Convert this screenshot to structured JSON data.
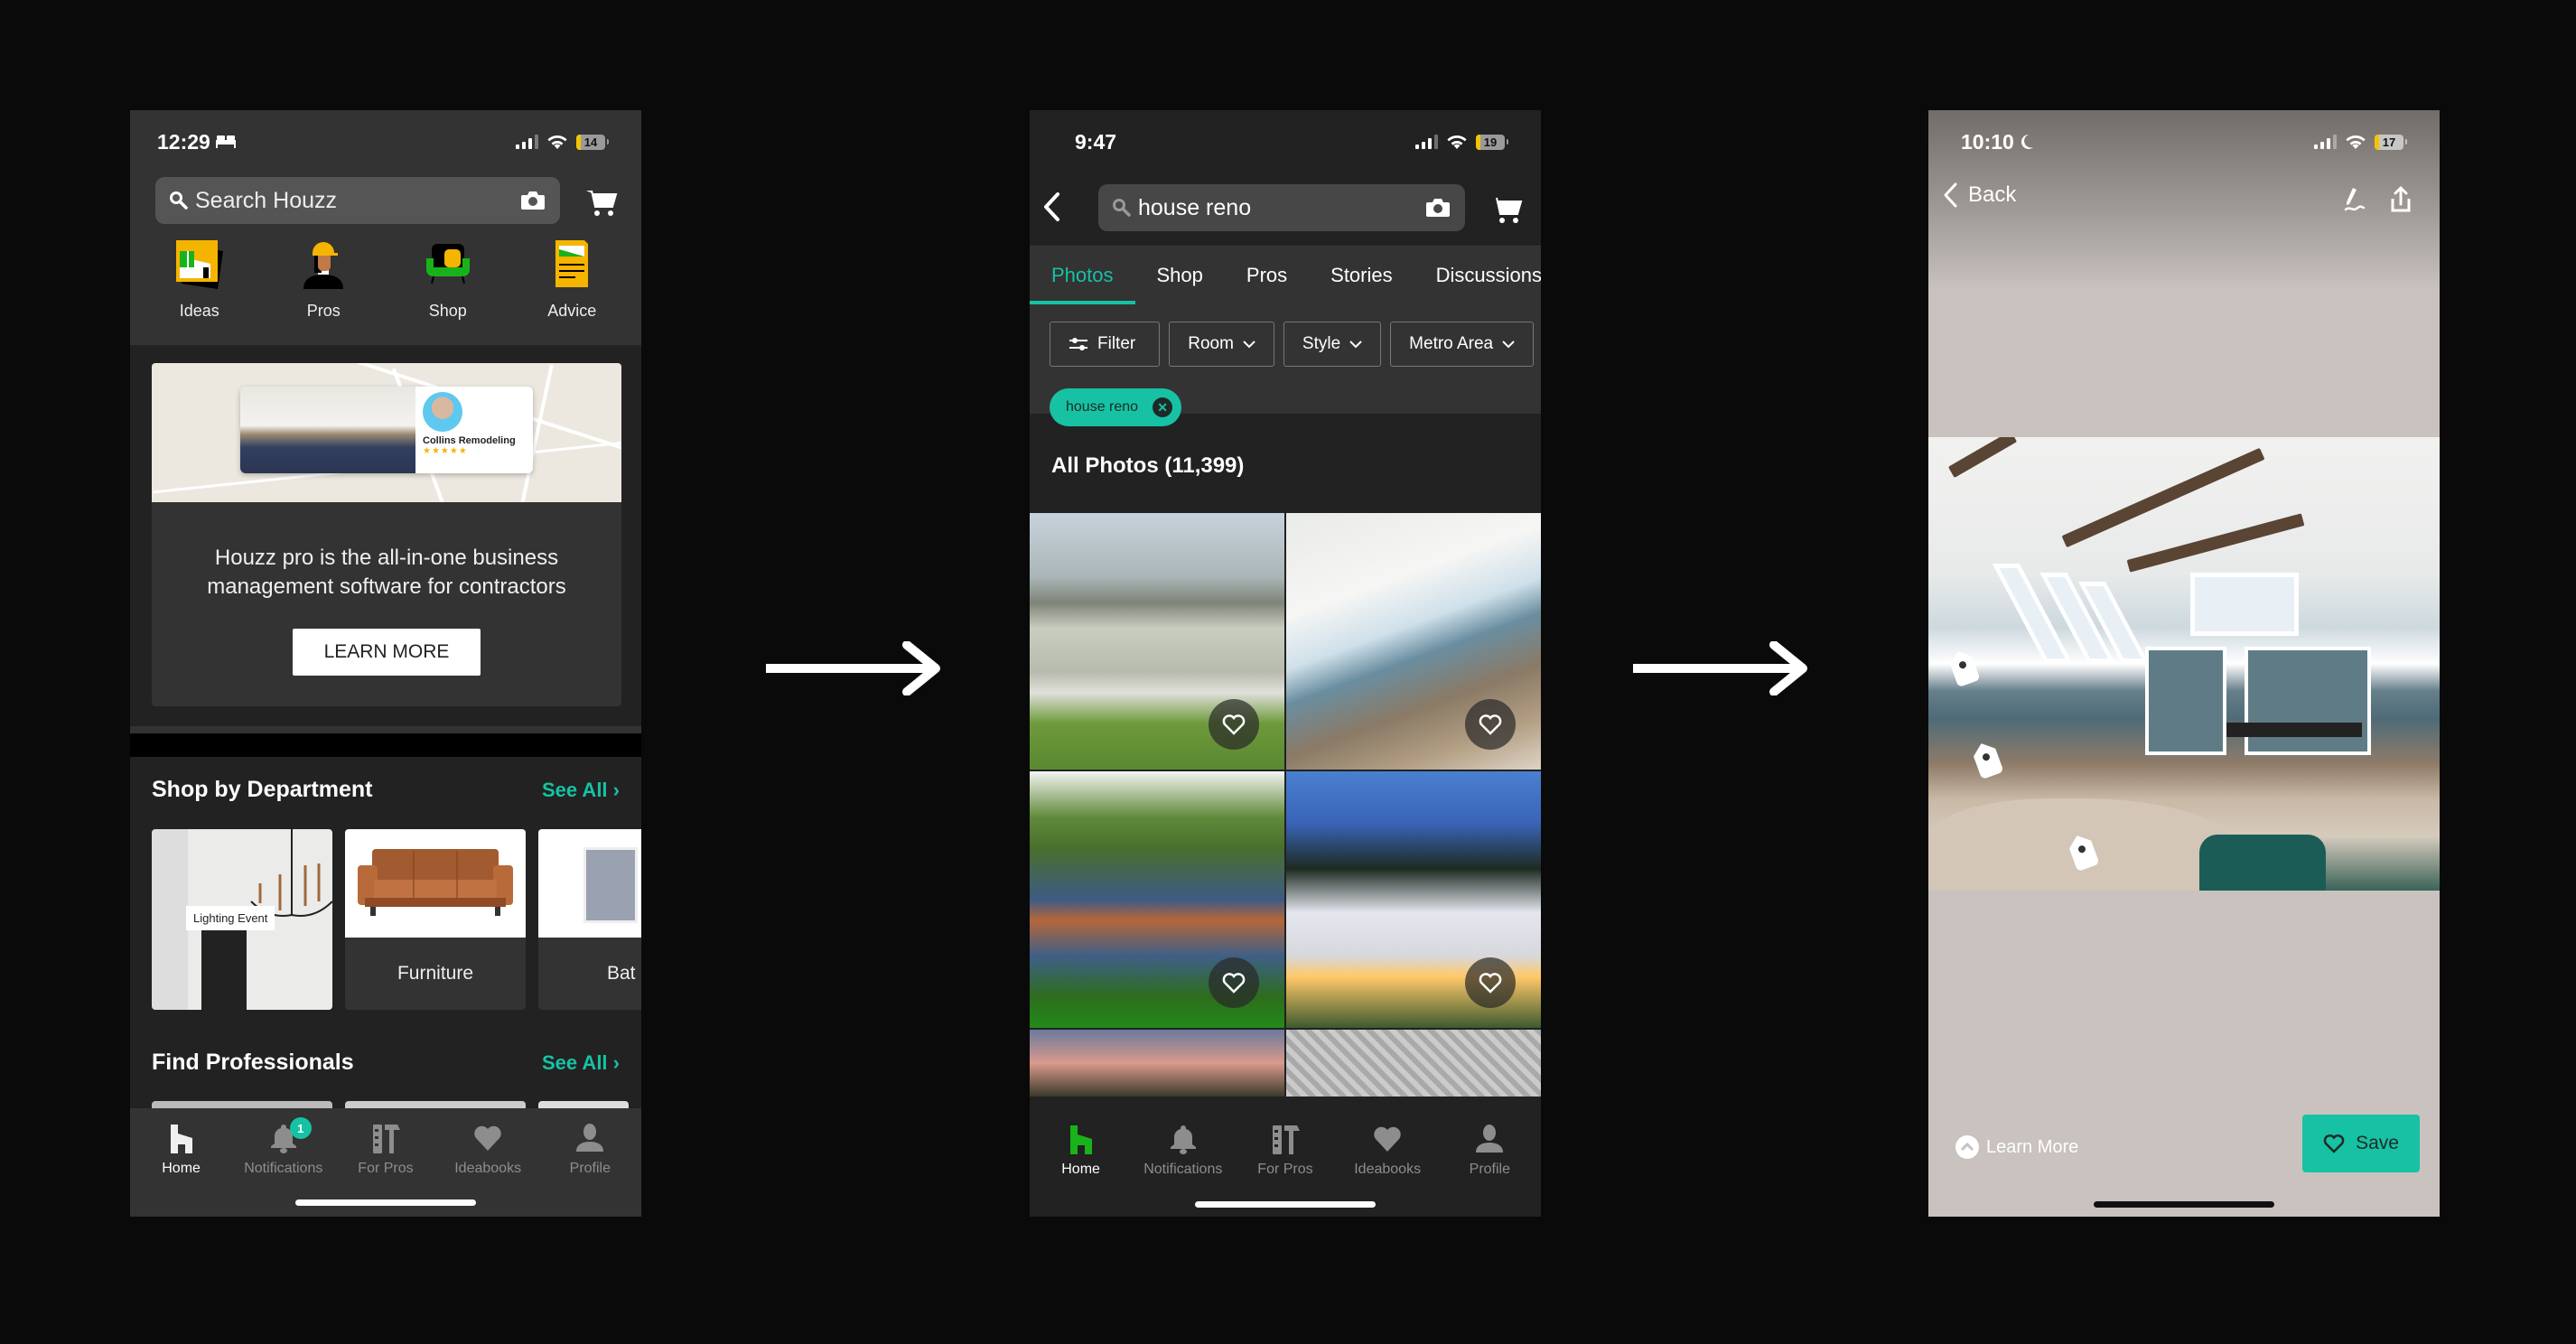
{
  "colors": {
    "accent_teal": "#16c2a3",
    "houzz_green": "#18b31a",
    "brand_yellow": "#f5b400",
    "background": "#0a0a0a"
  },
  "flow": {
    "arrows": [
      "arrow-right",
      "arrow-right"
    ]
  },
  "screen_home": {
    "status": {
      "time": "12:29",
      "mode_icon": "bed-icon",
      "battery": "14"
    },
    "search": {
      "placeholder": "Search Houzz",
      "camera_icon": "camera-icon"
    },
    "cart_icon": "cart-icon",
    "quick_links": [
      {
        "label": "Ideas",
        "icon": "ideas-icon"
      },
      {
        "label": "Pros",
        "icon": "pros-icon"
      },
      {
        "label": "Shop",
        "icon": "shop-icon"
      },
      {
        "label": "Advice",
        "icon": "advice-icon"
      }
    ],
    "promo": {
      "pro_name": "Collins Remodeling",
      "rating_stars": "★★★★★",
      "message_line1": "Houzz pro is the all-in-one business",
      "message_line2": "management software for contractors",
      "cta": "LEARN MORE"
    },
    "shop_by_department": {
      "title": "Shop by Department",
      "see_all": "See All",
      "items": [
        {
          "label": "Lighting Event"
        },
        {
          "label": "Furniture"
        },
        {
          "label": "Bat"
        }
      ]
    },
    "find_professionals": {
      "title": "Find Professionals",
      "see_all": "See All"
    },
    "bottom_nav": [
      {
        "label": "Home",
        "icon": "home-icon",
        "active": true
      },
      {
        "label": "Notifications",
        "icon": "bell-icon",
        "badge": "1"
      },
      {
        "label": "For Pros",
        "icon": "tools-icon"
      },
      {
        "label": "Ideabooks",
        "icon": "heart-icon"
      },
      {
        "label": "Profile",
        "icon": "profile-icon"
      }
    ]
  },
  "screen_search": {
    "status": {
      "time": "9:47",
      "battery": "19"
    },
    "search": {
      "value": "house reno"
    },
    "tabs": [
      {
        "label": "Photos",
        "active": true
      },
      {
        "label": "Shop"
      },
      {
        "label": "Pros"
      },
      {
        "label": "Stories"
      },
      {
        "label": "Discussions"
      }
    ],
    "filters": [
      {
        "label": "Filter",
        "icon": "sliders-icon"
      },
      {
        "label": "Room",
        "icon": "chevron-down-icon"
      },
      {
        "label": "Style",
        "icon": "chevron-down-icon"
      },
      {
        "label": "Metro Area",
        "icon": "chevron-down-icon"
      }
    ],
    "active_chip": "house reno",
    "results_title": "All Photos (11,399)",
    "photos": [
      {
        "subject": "craftsman bungalow exterior"
      },
      {
        "subject": "vaulted lake house kitchen and dining"
      },
      {
        "subject": "blue craftsman house exterior"
      },
      {
        "subject": "white foursquare house at dusk"
      },
      {
        "subject": "house exterior at sunset"
      },
      {
        "subject": "patterned tile bathroom"
      }
    ],
    "bottom_nav": [
      {
        "label": "Home",
        "icon": "home-icon",
        "active": true
      },
      {
        "label": "Notifications",
        "icon": "bell-icon"
      },
      {
        "label": "For Pros",
        "icon": "tools-icon"
      },
      {
        "label": "Ideabooks",
        "icon": "heart-icon"
      },
      {
        "label": "Profile",
        "icon": "profile-icon"
      }
    ]
  },
  "screen_photo": {
    "status": {
      "time": "10:10",
      "mode_icon": "moon-icon",
      "battery": "17"
    },
    "back_label": "Back",
    "actions": [
      "markup-icon",
      "share-icon"
    ],
    "photo_subject": "vaulted lake house kitchen and dining",
    "product_tags": 3,
    "learn_more": "Learn More",
    "save": "Save"
  }
}
